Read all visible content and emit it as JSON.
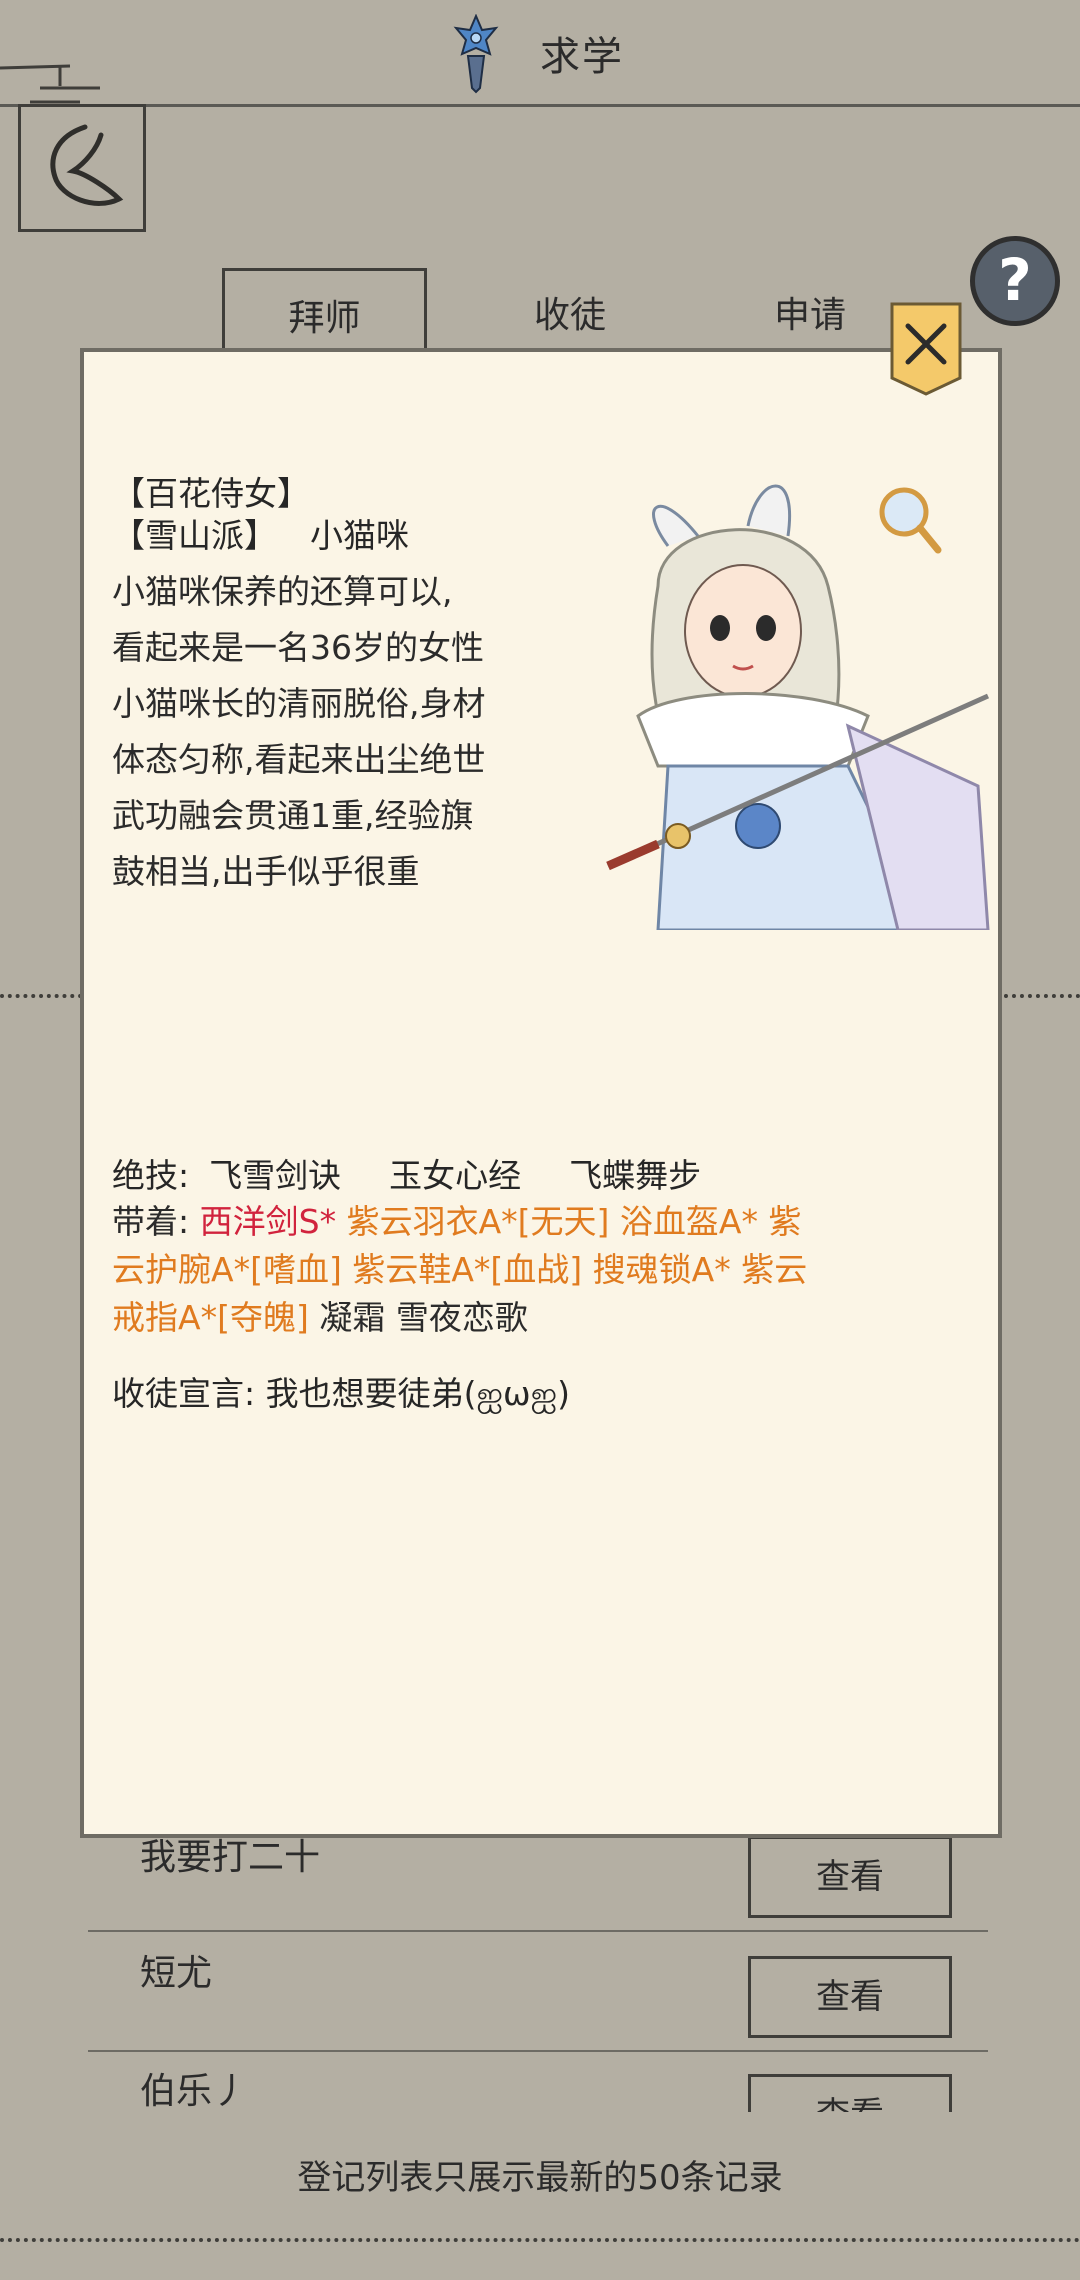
{
  "header": {
    "title": "求学",
    "icon": "sword-crest-icon"
  },
  "back_button": {
    "icon": "back-arrow-icon"
  },
  "help_button": {
    "label": "?"
  },
  "tabs": [
    {
      "label": "拜师",
      "active": true
    },
    {
      "label": "收徒",
      "active": false
    },
    {
      "label": "申请",
      "active": false
    }
  ],
  "list": {
    "rows": [
      {
        "name": "我要打二十",
        "button": "查看"
      },
      {
        "name": "短尤",
        "button": "查看"
      },
      {
        "name": "伯乐丿",
        "button": "查看"
      }
    ],
    "footer_note": "登记列表只展示最新的50条记录"
  },
  "modal": {
    "close_icon": "close-x-icon",
    "title_tag": "【百花侍女】",
    "sect_tag": "【雪山派】",
    "name": "小猫咪",
    "description_lines": [
      "小猫咪保养的还算可以,",
      "看起来是一名36岁的女性",
      "小猫咪长的清丽脱俗,身材",
      "体态匀称,看起来出尘绝世",
      "武功融会贯通1重,经验旗",
      "鼓相当,出手似乎很重"
    ],
    "portrait": "swordswoman-portrait",
    "skills_label": "绝技:",
    "skills": [
      "飞雪剑诀",
      "玉女心经",
      "飞蝶舞步"
    ],
    "equip_label": "带着:",
    "equip_lines": [
      [
        {
          "text": "西洋剑S*",
          "color": "red"
        },
        {
          "text": "紫云羽衣A*[无天]",
          "color": "orange"
        },
        {
          "text": "浴血盔A*",
          "color": "orange"
        },
        {
          "text": "紫",
          "color": "orange"
        }
      ],
      [
        {
          "text": "云护腕A*[嗜血]",
          "color": "orange"
        },
        {
          "text": "紫云鞋A*[血战]",
          "color": "orange"
        },
        {
          "text": "搜魂锁A*",
          "color": "orange"
        },
        {
          "text": "紫云",
          "color": "orange"
        }
      ],
      [
        {
          "text": "戒指A*[夺魄]",
          "color": "orange"
        },
        {
          "text": "凝霜",
          "color": "plain"
        },
        {
          "text": "雪夜恋歌",
          "color": "plain"
        }
      ]
    ],
    "declaration_label": "收徒宣言:",
    "declaration": "我也想要徒弟(ஐωஐ)"
  },
  "colors": {
    "background": "#b4afa3",
    "modal_bg": "#fbf5e6",
    "red_item": "#d1233d",
    "orange_item": "#e07b1f"
  }
}
